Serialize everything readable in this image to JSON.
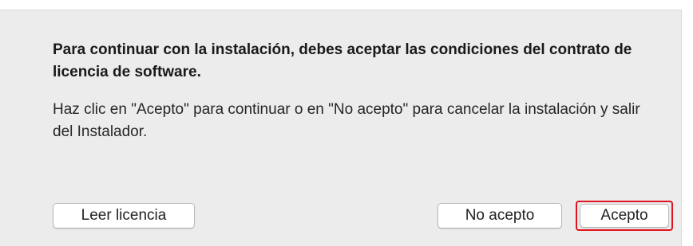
{
  "dialog": {
    "heading": "Para continuar con la instalación, debes aceptar las condiciones del contrato de licencia de software.",
    "body": "Haz clic en \"Acepto\" para continuar o en \"No acepto\" para cancelar la instalación y salir del Instalador."
  },
  "buttons": {
    "read_license_label": "Leer licencia",
    "decline_label": "No acepto",
    "accept_label": "Acepto"
  },
  "colors": {
    "sheet_background": "#ececec",
    "highlight_border": "#e0141e",
    "button_background": "#ffffff"
  }
}
